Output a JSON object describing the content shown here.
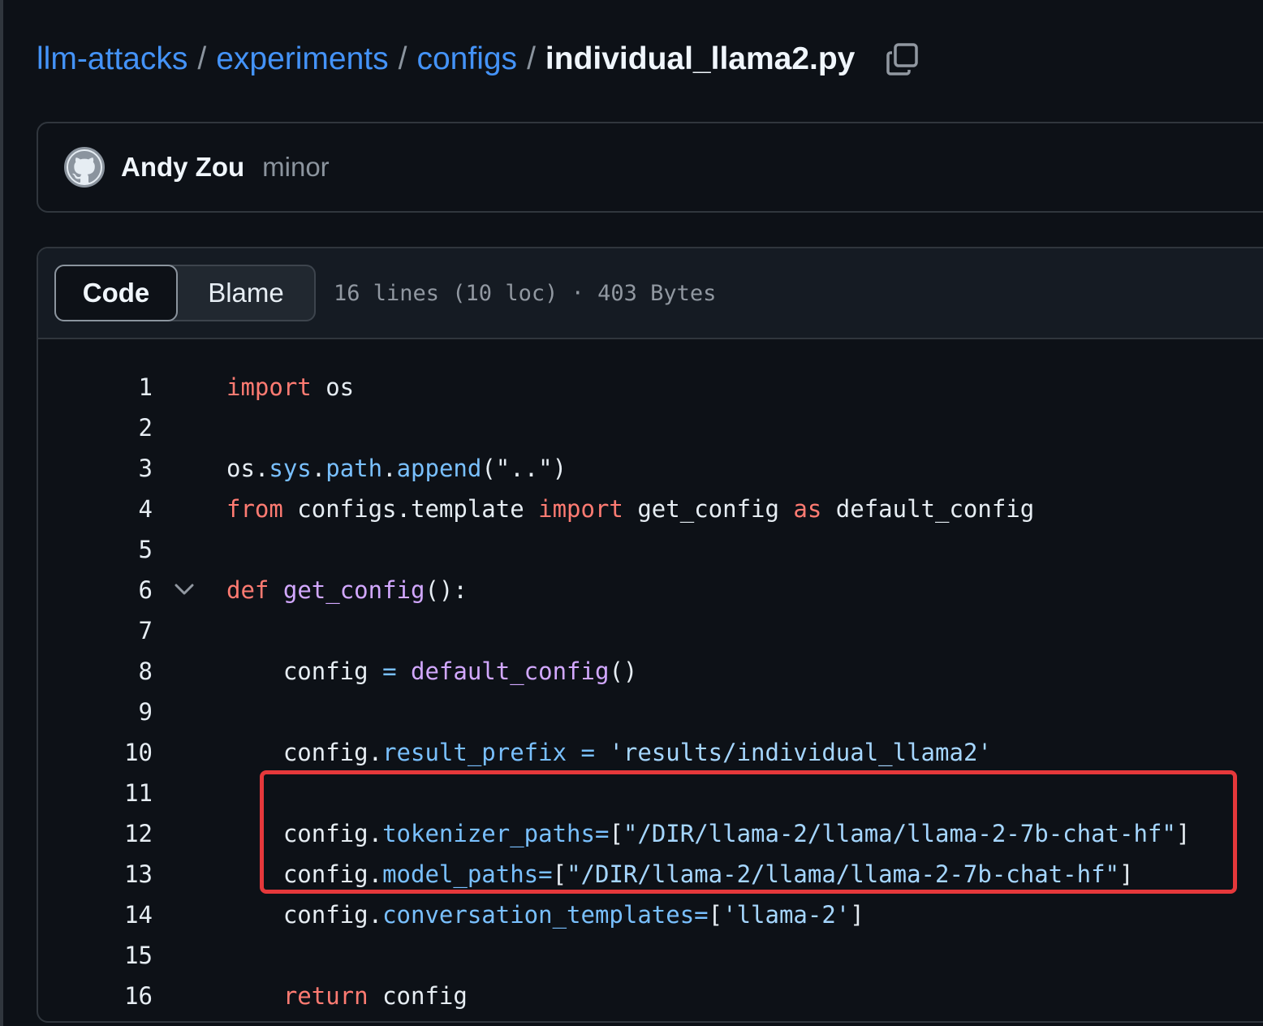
{
  "breadcrumb": {
    "repo": "llm-attacks",
    "dir1": "experiments",
    "dir2": "configs",
    "file": "individual_llama2.py",
    "separator": "/"
  },
  "commit": {
    "author": "Andy Zou",
    "message": "minor"
  },
  "file_view": {
    "tabs": [
      "Code",
      "Blame"
    ],
    "active_tab": "Code",
    "meta": "16 lines (10 loc) · 403 Bytes"
  },
  "code_lines": [
    {
      "n": "1",
      "tokens": [
        [
          "kw",
          "import"
        ],
        [
          "t",
          " os"
        ]
      ]
    },
    {
      "n": "2",
      "tokens": []
    },
    {
      "n": "3",
      "tokens": [
        [
          "t",
          "os."
        ],
        [
          "at",
          "sys"
        ],
        [
          "t",
          "."
        ],
        [
          "at",
          "path"
        ],
        [
          "t",
          "."
        ],
        [
          "at",
          "append"
        ],
        [
          "t",
          "(\"..\")"
        ]
      ]
    },
    {
      "n": "4",
      "tokens": [
        [
          "kw",
          "from"
        ],
        [
          "t",
          " configs.template "
        ],
        [
          "kw",
          "import"
        ],
        [
          "t",
          " get_config "
        ],
        [
          "kw",
          "as"
        ],
        [
          "t",
          " default_config"
        ]
      ]
    },
    {
      "n": "5",
      "tokens": []
    },
    {
      "n": "6",
      "tokens": [
        [
          "kw",
          "def"
        ],
        [
          "t",
          " "
        ],
        [
          "fn",
          "get_config"
        ],
        [
          "t",
          "():"
        ]
      ]
    },
    {
      "n": "7",
      "tokens": []
    },
    {
      "n": "8",
      "tokens": [
        [
          "t",
          "    config "
        ],
        [
          "op",
          "="
        ],
        [
          "t",
          " "
        ],
        [
          "fn",
          "default_config"
        ],
        [
          "t",
          "()"
        ]
      ]
    },
    {
      "n": "9",
      "tokens": []
    },
    {
      "n": "10",
      "tokens": [
        [
          "t",
          "    config."
        ],
        [
          "at",
          "result_prefix"
        ],
        [
          "t",
          " "
        ],
        [
          "op",
          "="
        ],
        [
          "t",
          " "
        ],
        [
          "st",
          "'results/individual_llama2'"
        ]
      ]
    },
    {
      "n": "11",
      "tokens": []
    },
    {
      "n": "12",
      "tokens": [
        [
          "t",
          "    config."
        ],
        [
          "at",
          "tokenizer_paths"
        ],
        [
          "op",
          "="
        ],
        [
          "t",
          "["
        ],
        [
          "st",
          "\"/DIR/llama-2/llama/llama-2-7b-chat-hf\""
        ],
        [
          "t",
          "]"
        ]
      ]
    },
    {
      "n": "13",
      "tokens": [
        [
          "t",
          "    config."
        ],
        [
          "at",
          "model_paths"
        ],
        [
          "op",
          "="
        ],
        [
          "t",
          "["
        ],
        [
          "st",
          "\"/DIR/llama-2/llama/llama-2-7b-chat-hf\""
        ],
        [
          "t",
          "]"
        ]
      ]
    },
    {
      "n": "14",
      "tokens": [
        [
          "t",
          "    config."
        ],
        [
          "at",
          "conversation_templates"
        ],
        [
          "op",
          "="
        ],
        [
          "t",
          "["
        ],
        [
          "st",
          "'llama-2'"
        ],
        [
          "t",
          "]"
        ]
      ]
    },
    {
      "n": "15",
      "tokens": []
    },
    {
      "n": "16",
      "tokens": [
        [
          "t",
          "    "
        ],
        [
          "kw",
          "return"
        ],
        [
          "t",
          " config"
        ]
      ]
    }
  ],
  "colors": {
    "background": "#0d1117",
    "link": "#4493f8",
    "keyword": "#ff7b72",
    "function": "#d2a8ff",
    "attribute": "#79c0ff",
    "string": "#a5d6ff",
    "highlight_border": "#e5383b"
  },
  "icons": {
    "copy": "copy-icon",
    "avatar": "github-octocat-icon",
    "fold": "chevron-down-icon"
  }
}
